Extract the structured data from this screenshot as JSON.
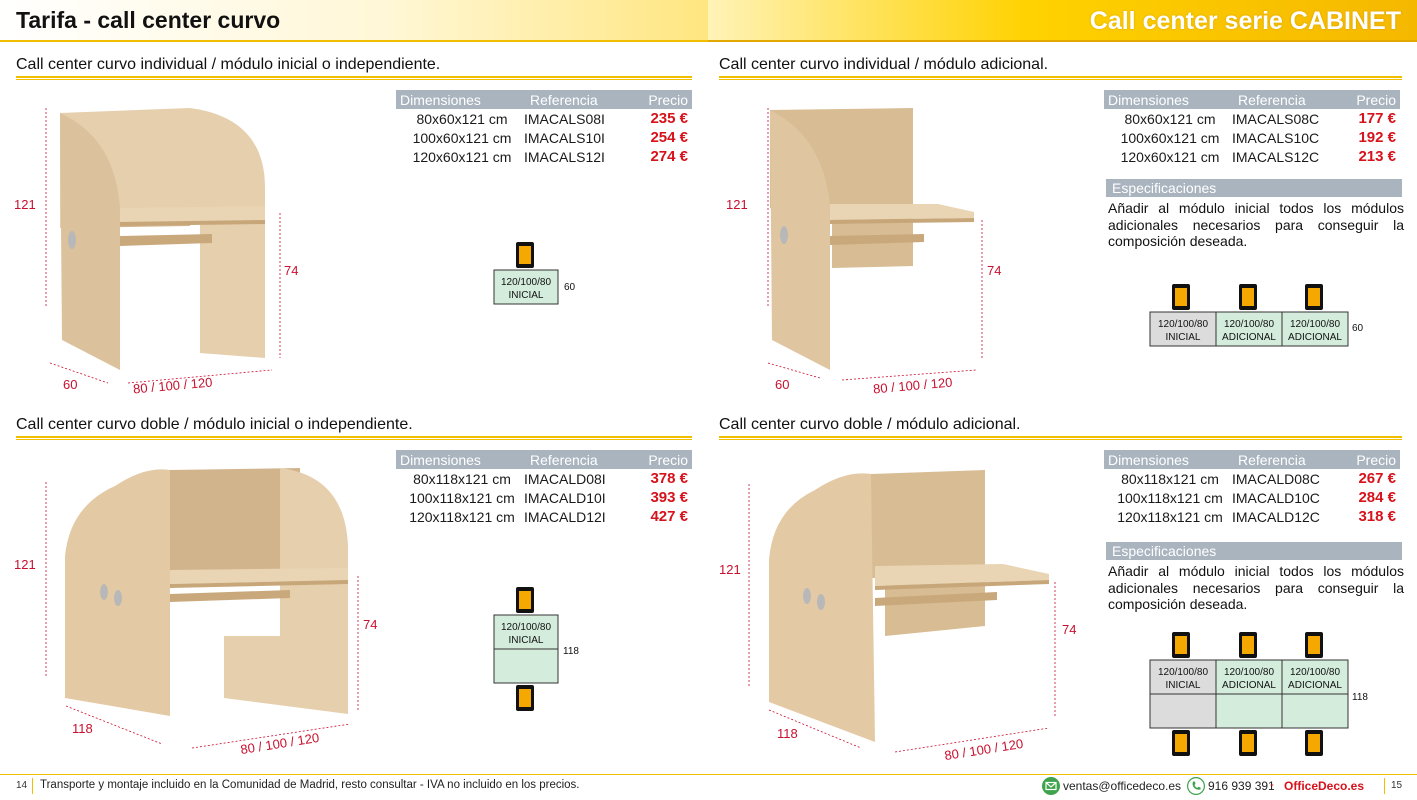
{
  "header": {
    "title": "Tarifa - call center curvo",
    "series": "Call center serie CABINET"
  },
  "table_headers": {
    "dim": "Dimensiones",
    "ref": "Referencia",
    "price": "Precio"
  },
  "sections": [
    {
      "title": "Call center curvo individual / módulo inicial o independiente.",
      "rows": [
        {
          "dim": "80x60x121 cm",
          "ref": "IMACALS08I",
          "price": "235 €"
        },
        {
          "dim": "100x60x121 cm",
          "ref": "IMACALS10I",
          "price": "254 €"
        },
        {
          "dim": "120x60x121 cm",
          "ref": "IMACALS12I",
          "price": "274 €"
        }
      ],
      "dims": {
        "height": "121",
        "desk_height": "74",
        "depth": "60",
        "width": "80 / 100 / 120"
      },
      "layout": {
        "module_size": "120/100/80",
        "module_label": "INICIAL",
        "depth": "60"
      }
    },
    {
      "title": "Call center curvo individual / módulo adicional.",
      "rows": [
        {
          "dim": "80x60x121 cm",
          "ref": "IMACALS08C",
          "price": "177 €"
        },
        {
          "dim": "100x60x121 cm",
          "ref": "IMACALS10C",
          "price": "192 €"
        },
        {
          "dim": "120x60x121 cm",
          "ref": "IMACALS12C",
          "price": "213 €"
        }
      ],
      "spec_title": "Especificaciones",
      "spec_text": "Añadir al módulo inicial todos los módulos adicionales necesarios para conseguir la composición deseada.",
      "dims": {
        "height": "121",
        "desk_height": "74",
        "depth": "60",
        "width": "80 / 100 / 120"
      },
      "layout": {
        "module_size": "120/100/80",
        "labels": [
          "INICIAL",
          "ADICIONAL",
          "ADICIONAL"
        ],
        "depth": "60"
      }
    },
    {
      "title": "Call center curvo doble / módulo inicial o independiente.",
      "rows": [
        {
          "dim": "80x118x121 cm",
          "ref": "IMACALD08I",
          "price": "378 €"
        },
        {
          "dim": "100x118x121 cm",
          "ref": "IMACALD10I",
          "price": "393 €"
        },
        {
          "dim": "120x118x121 cm",
          "ref": "IMACALD12I",
          "price": "427 €"
        }
      ],
      "dims": {
        "height": "121",
        "desk_height": "74",
        "depth": "118",
        "width": "80 / 100 / 120"
      },
      "layout": {
        "module_size": "120/100/80",
        "module_label": "INICIAL",
        "depth": "118"
      }
    },
    {
      "title": "Call center curvo doble / módulo adicional.",
      "rows": [
        {
          "dim": "80x118x121 cm",
          "ref": "IMACALD08C",
          "price": "267 €"
        },
        {
          "dim": "100x118x121 cm",
          "ref": "IMACALD10C",
          "price": "284 €"
        },
        {
          "dim": "120x118x121 cm",
          "ref": "IMACALD12C",
          "price": "318 €"
        }
      ],
      "spec_title": "Especificaciones",
      "spec_text": "Añadir al módulo inicial todos los módulos adicionales necesarios para conseguir la composición deseada.",
      "dims": {
        "height": "121",
        "desk_height": "74",
        "depth": "118",
        "width": "80 / 100 / 120"
      },
      "layout": {
        "module_size": "120/100/80",
        "labels": [
          "INICIAL",
          "ADICIONAL",
          "ADICIONAL"
        ],
        "depth": "118"
      }
    }
  ],
  "footer": {
    "page_left": "14",
    "page_right": "15",
    "note": "Transporte y montaje incluido en la Comunidad de Madrid, resto consultar - IVA no incluido en los precios.",
    "email": "ventas@officedeco.es",
    "phone": "916 939 391",
    "separator": "-",
    "brand": "OfficeDeco.es"
  },
  "colors": {
    "accent_yellow": "#f0c000",
    "price_red": "#d6121b",
    "table_header": "#a9b4bf",
    "wood": "#e3cba8",
    "module_green": "#d4ecdc",
    "module_gray": "#dcdcdc",
    "chair_orange": "#f5a800"
  }
}
